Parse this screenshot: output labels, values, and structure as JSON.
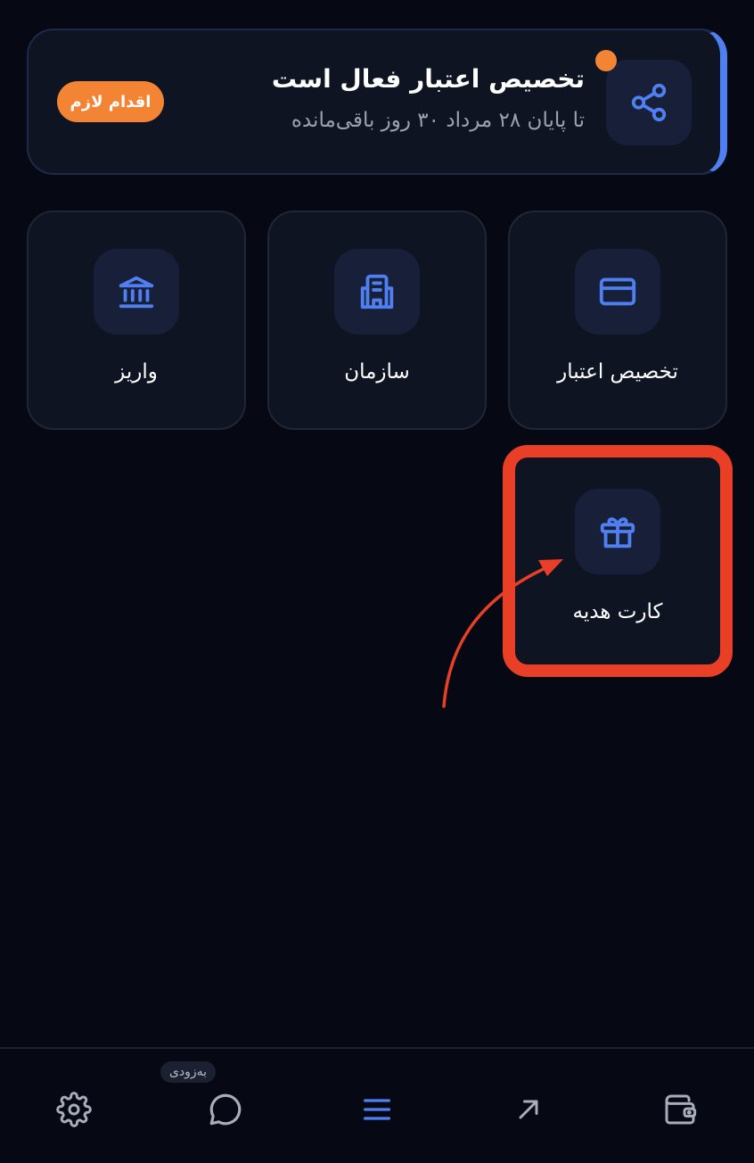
{
  "banner": {
    "title": "تخصیص اعتبار فعال است",
    "subtitle": "تا پایان ۲۸ مرداد ۳۰ روز باقی‌مانده",
    "badge": "اقدام لازم",
    "icon": "share-icon",
    "accent": "#4f7ff0",
    "badge_color": "#f38434"
  },
  "tiles": [
    {
      "label": "تخصیص اعتبار",
      "icon": "credit-card-icon"
    },
    {
      "label": "سازمان",
      "icon": "building-icon"
    },
    {
      "label": "واریز",
      "icon": "bank-icon"
    },
    {
      "label": "کارت هدیه",
      "icon": "gift-icon"
    }
  ],
  "bottom_nav": {
    "items": [
      {
        "name": "settings",
        "icon": "gear-icon"
      },
      {
        "name": "chat",
        "icon": "chat-bubble-icon",
        "badge": "به‌زودی"
      },
      {
        "name": "menu",
        "icon": "menu-icon",
        "active": true
      },
      {
        "name": "send",
        "icon": "arrow-up-right-icon"
      },
      {
        "name": "wallet",
        "icon": "wallet-icon"
      }
    ]
  },
  "colors": {
    "background": "#060914",
    "card": "#0f1422",
    "icon_blue": "#4f7ff0",
    "highlight_red": "#e83f26"
  }
}
